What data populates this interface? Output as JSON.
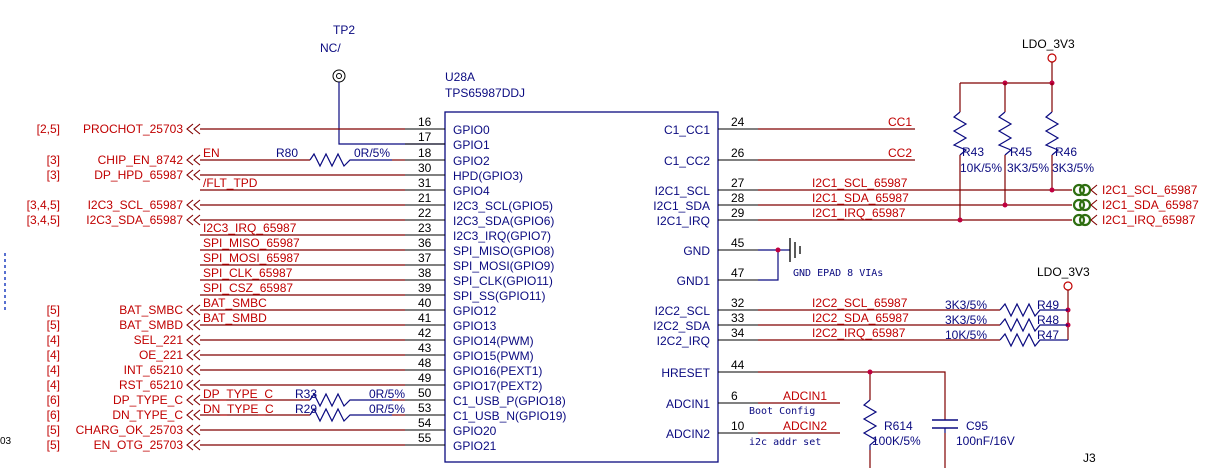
{
  "colors": {
    "net": "#c00000",
    "wire": "#800000",
    "part": "#0a0a80",
    "pin_text": "#0a0a80",
    "junction": "#c00040",
    "port": "#2e6e10"
  },
  "chip": {
    "designator": "U28A",
    "part_number": "TPS65987DDJ"
  },
  "test_point": {
    "designator": "TP2",
    "value": "NC/"
  },
  "power": {
    "ldo_top": "LDO_3V3",
    "ldo_mid": "LDO_3V3"
  },
  "left_pins": [
    {
      "num": "16",
      "name": "GPIO0"
    },
    {
      "num": "17",
      "name": "GPIO1"
    },
    {
      "num": "18",
      "name": "GPIO2"
    },
    {
      "num": "30",
      "name": "HPD(GPIO3)"
    },
    {
      "num": "31",
      "name": "GPIO4"
    },
    {
      "num": "21",
      "name": "I2C3_SCL(GPIO5)"
    },
    {
      "num": "22",
      "name": "I2C3_SDA(GPIO6)"
    },
    {
      "num": "23",
      "name": "I2C3_IRQ(GPIO7)"
    },
    {
      "num": "36",
      "name": "SPI_MISO(GPIO8)"
    },
    {
      "num": "37",
      "name": "SPI_MOSI(GPIO9)"
    },
    {
      "num": "38",
      "name": "SPI_CLK(GPIO11)"
    },
    {
      "num": "39",
      "name": "SPI_SS(GPIO11)"
    },
    {
      "num": "40",
      "name": "GPIO12"
    },
    {
      "num": "41",
      "name": "GPIO13"
    },
    {
      "num": "42",
      "name": "GPIO14(PWM)"
    },
    {
      "num": "43",
      "name": "GPIO15(PWM)"
    },
    {
      "num": "48",
      "name": "GPIO16(PEXT1)"
    },
    {
      "num": "49",
      "name": "GPIO17(PEXT2)"
    },
    {
      "num": "50",
      "name": "C1_USB_P(GPIO18)"
    },
    {
      "num": "53",
      "name": "C1_USB_N(GPIO19)"
    },
    {
      "num": "54",
      "name": "GPIO20"
    },
    {
      "num": "55",
      "name": "GPIO21"
    }
  ],
  "right_pins": [
    {
      "num": "24",
      "name": "C1_CC1"
    },
    {
      "num": "26",
      "name": "C1_CC2"
    },
    {
      "num": "27",
      "name": "I2C1_SCL"
    },
    {
      "num": "28",
      "name": "I2C1_SDA"
    },
    {
      "num": "29",
      "name": "I2C1_IRQ"
    },
    {
      "num": "45",
      "name": "GND"
    },
    {
      "num": "47",
      "name": "GND1"
    },
    {
      "num": "32",
      "name": "I2C2_SCL"
    },
    {
      "num": "33",
      "name": "I2C2_SDA"
    },
    {
      "num": "34",
      "name": "I2C2_IRQ"
    },
    {
      "num": "44",
      "name": "HRESET"
    },
    {
      "num": "6",
      "name": "ADCIN1"
    },
    {
      "num": "10",
      "name": "ADCIN2"
    }
  ],
  "left_ports": [
    {
      "ref": "[2,5]",
      "name": "PROCHOT_25703"
    },
    {
      "ref": "[3]",
      "name": "CHIP_EN_8742"
    },
    {
      "ref": "[3]",
      "name": "DP_HPD_65987"
    },
    {
      "ref": "[3,4,5]",
      "name": "I2C3_SCL_65987"
    },
    {
      "ref": "[3,4,5]",
      "name": "I2C3_SDA_65987"
    },
    {
      "ref": "[5]",
      "name": "BAT_SMBC"
    },
    {
      "ref": "[5]",
      "name": "BAT_SMBD"
    },
    {
      "ref": "[4]",
      "name": "SEL_221"
    },
    {
      "ref": "[4]",
      "name": "OE_221"
    },
    {
      "ref": "[4]",
      "name": "INT_65210"
    },
    {
      "ref": "[4]",
      "name": "RST_65210"
    },
    {
      "ref": "[6]",
      "name": "DP_TYPE_C"
    },
    {
      "ref": "[6]",
      "name": "DN_TYPE_C"
    },
    {
      "ref": "[5]",
      "name": "CHARG_OK_25703"
    },
    {
      "ref": "[5]",
      "name": "EN_OTG_25703"
    }
  ],
  "left_nets": {
    "en": "EN",
    "flt": "/FLT_TPD",
    "i2c3_irq": "I2C3_IRQ_65987",
    "spi_miso": "SPI_MISO_65987",
    "spi_mosi": "SPI_MOSI_65987",
    "spi_clk": "SPI_CLK_65987",
    "spi_csz": "SPI_CSZ_65987",
    "bat_smbc": "BAT_SMBC",
    "bat_smbd": "BAT_SMBD",
    "dp_type_c": "DP_TYPE_C",
    "dn_type_c": "DN_TYPE_C"
  },
  "right_nets": {
    "cc1": "CC1",
    "cc2": "CC2",
    "i2c1_scl": "I2C1_SCL_65987",
    "i2c1_sda": "I2C1_SDA_65987",
    "i2c1_irq": "I2C1_IRQ_65987",
    "i2c2_scl": "I2C2_SCL_65987",
    "i2c2_sda": "I2C2_SDA_65987",
    "i2c2_irq": "I2C2_IRQ_65987",
    "adcin1": "ADCIN1",
    "adcin2": "ADCIN2"
  },
  "right_ports": [
    {
      "name": "I2C1_SCL_65987"
    },
    {
      "name": "I2C1_SDA_65987"
    },
    {
      "name": "I2C1_IRQ_65987"
    }
  ],
  "resistors": {
    "r80": {
      "ref": "R80",
      "value": "0R/5%"
    },
    "r33": {
      "ref": "R33",
      "value": "0R/5%"
    },
    "r29": {
      "ref": "R29",
      "value": "0R/5%"
    },
    "r43": {
      "ref": "R43",
      "value": "10K/5%"
    },
    "r45": {
      "ref": "R45",
      "value": "3K3/5%"
    },
    "r46": {
      "ref": "R46",
      "value": "3K3/5%"
    },
    "r49": {
      "ref": "R49",
      "value": "3K3/5%"
    },
    "r48": {
      "ref": "R48",
      "value": "3K3/5%"
    },
    "r47": {
      "ref": "R47",
      "value": "10K/5%"
    },
    "r614": {
      "ref": "R614",
      "value": "100K/5%"
    }
  },
  "capacitor": {
    "ref": "C95",
    "value": "100nF/16V"
  },
  "notes": {
    "gnd": "GND EPAD 8 VIAs",
    "boot": "Boot Config",
    "i2c_addr": "i2c addr set"
  },
  "fragments": {
    "left_edge": "03",
    "connector": "J3"
  }
}
